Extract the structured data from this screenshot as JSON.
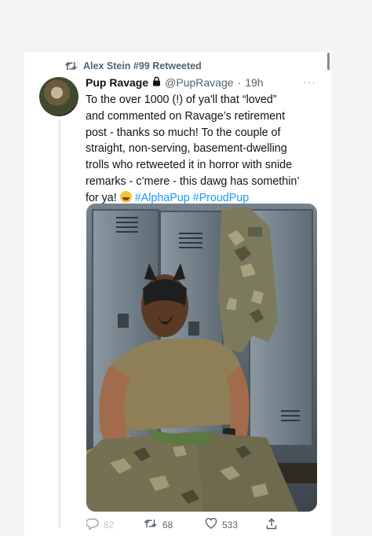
{
  "retweet": {
    "label": "Alex Stein #99 Retweeted",
    "icon": "retweet-icon"
  },
  "tweet": {
    "author_name": "Pup Ravage",
    "lock_icon": "lock-icon",
    "handle": "@PupRavage",
    "separator": "·",
    "time": "19h",
    "more_icon": "more-icon",
    "text_lines": [
      "To the over 1000 (!) of ya'll that “loved”",
      "and commented on Ravage’s retirement",
      "post - thanks so much! To the couple of",
      "straight, non-serving, basement-dwelling",
      "trolls who retweeted it in horror with snide",
      "remarks - c’mere - this dawg has somethin’"
    ],
    "text_last_prefix": "for ya!",
    "emoji_icon": "grinning-sweat-emoji",
    "hashtags": [
      "#AlphaPup",
      "#ProudPup"
    ]
  },
  "media": {
    "description": "locker-room photo"
  },
  "actions": {
    "reply": {
      "icon": "reply-icon",
      "count": "82"
    },
    "retweet": {
      "icon": "retweet-icon",
      "count": "68"
    },
    "like": {
      "icon": "heart-icon",
      "count": "533"
    },
    "share": {
      "icon": "share-icon"
    }
  },
  "colors": {
    "text": "#0f1419",
    "secondary": "#536471",
    "link": "#1d9bf0"
  }
}
